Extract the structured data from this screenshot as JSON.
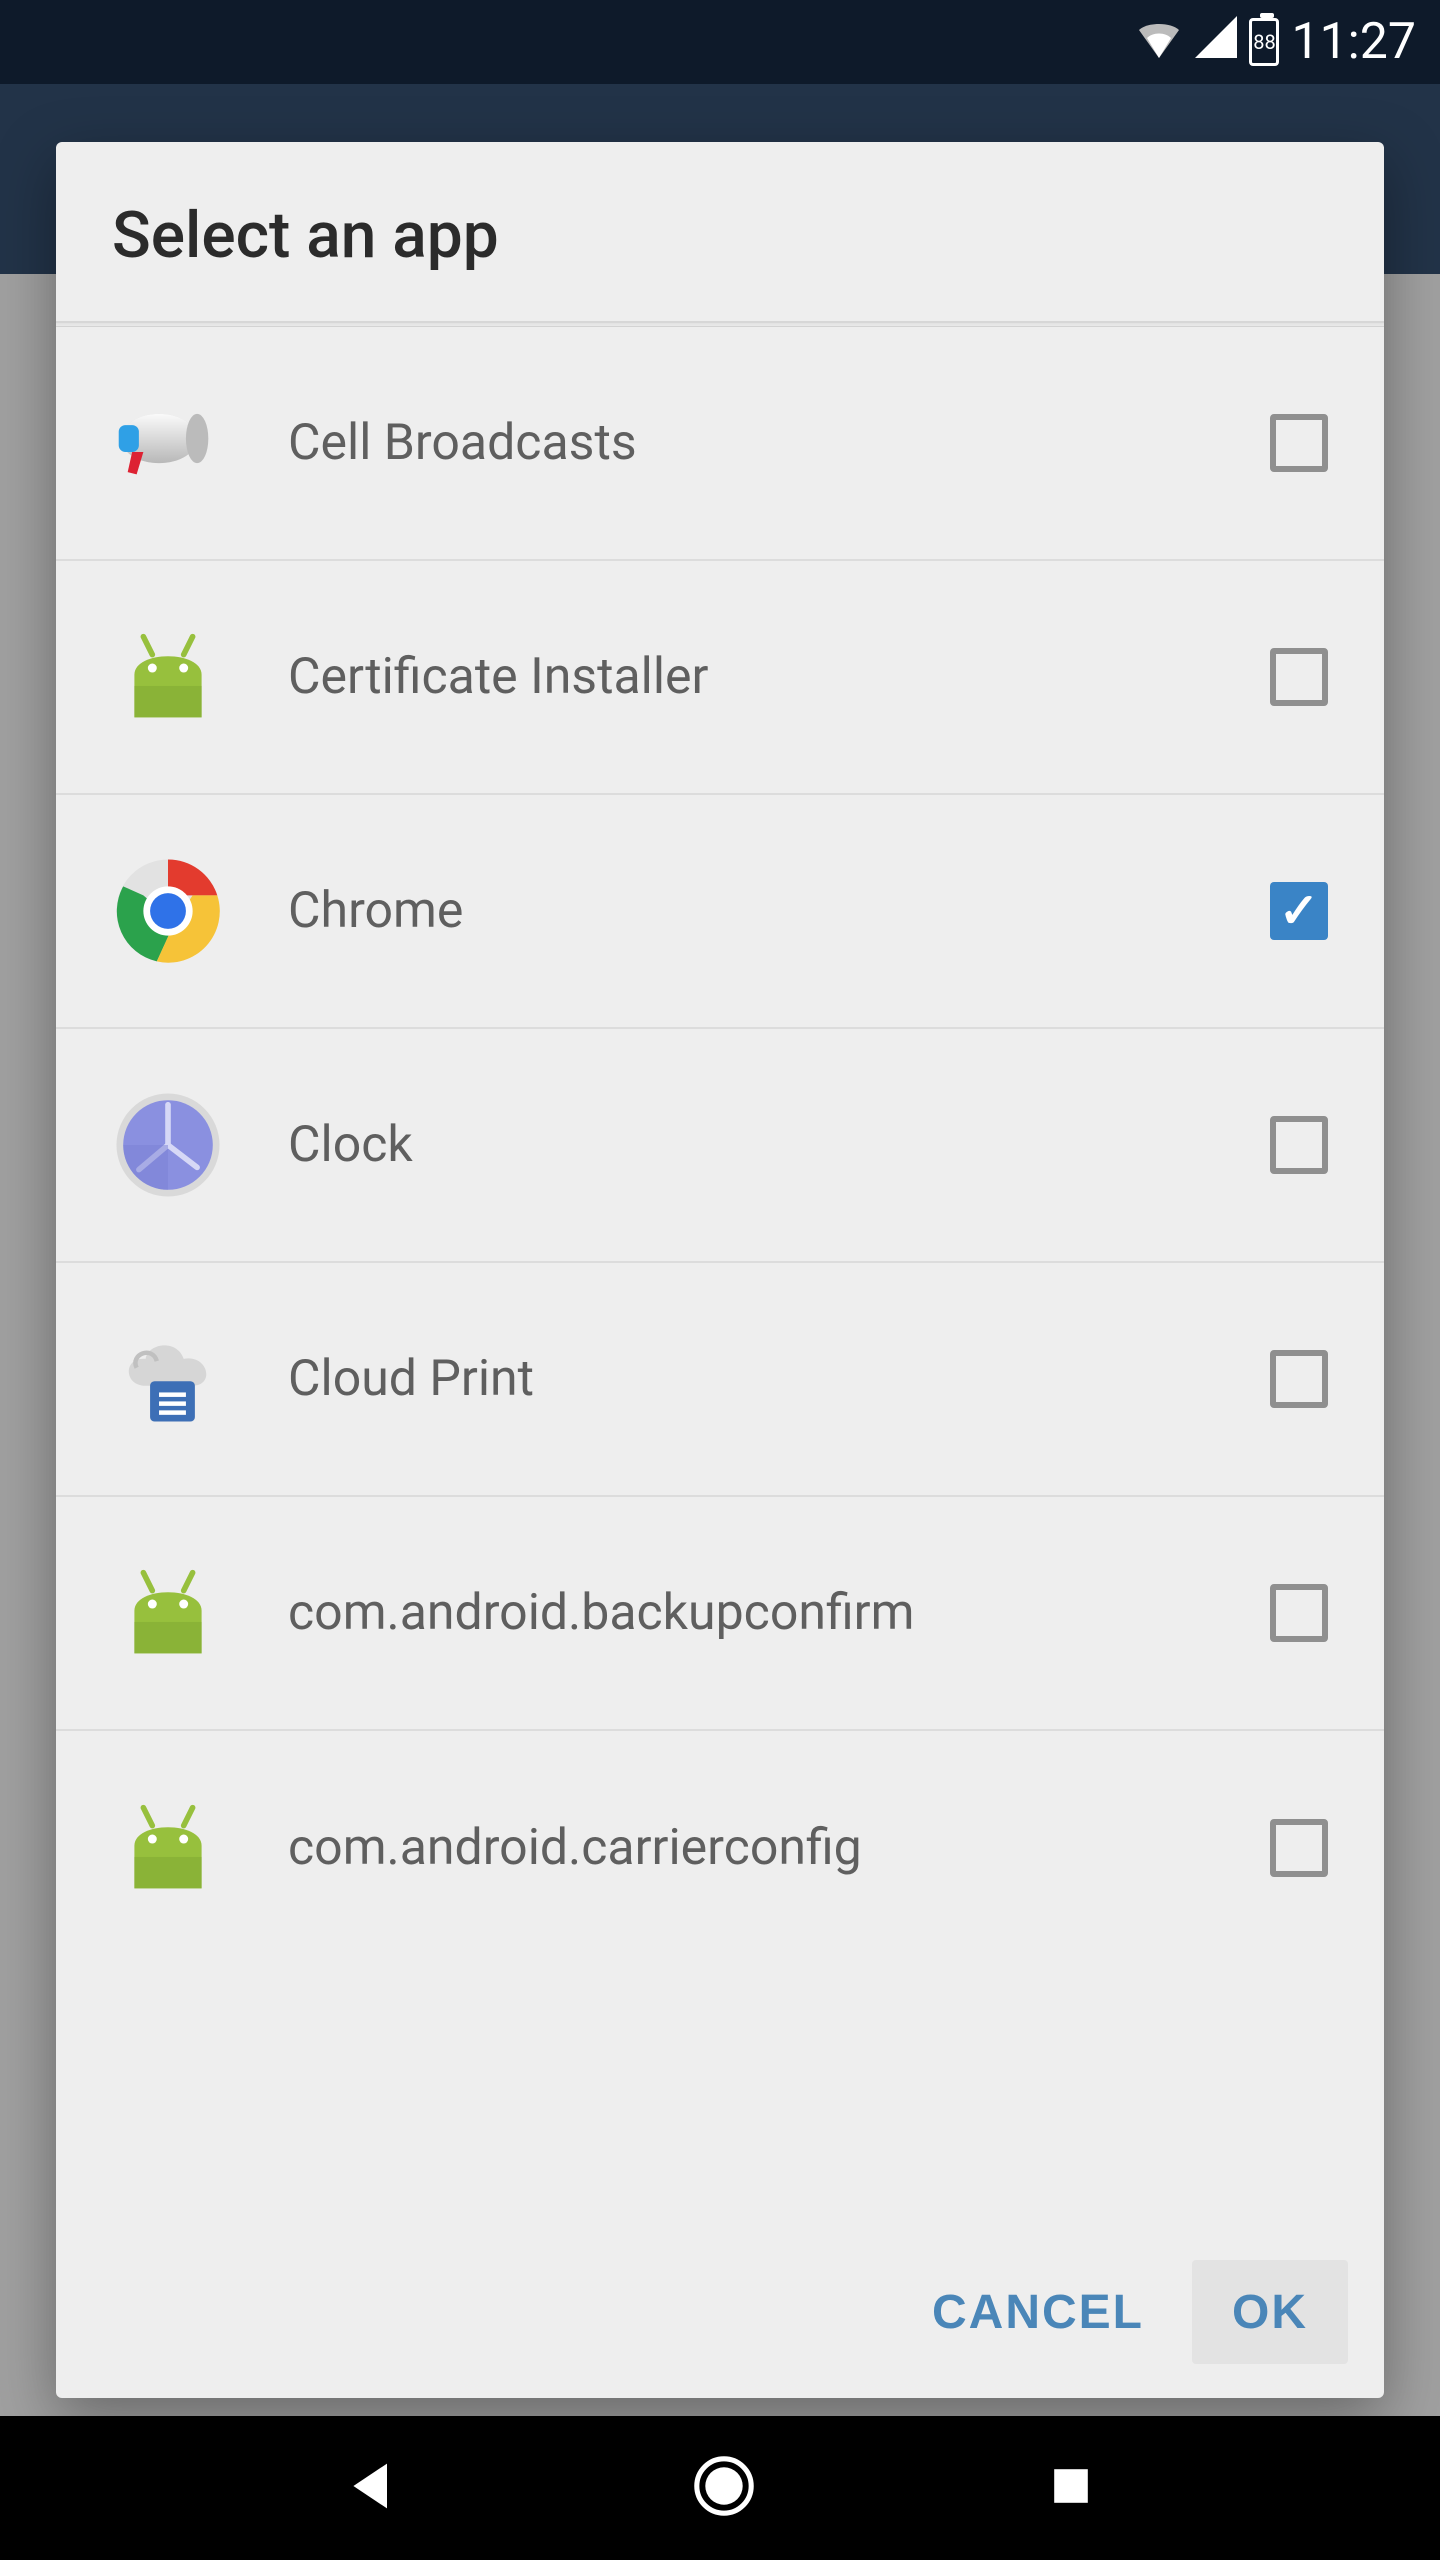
{
  "statusbar": {
    "time": "11:27",
    "battery": "88"
  },
  "dialog": {
    "title": "Select an app",
    "apps": [
      {
        "name": "Cell Broadcasts",
        "checked": false,
        "icon": "megaphone-icon"
      },
      {
        "name": "Certificate Installer",
        "checked": false,
        "icon": "android-icon"
      },
      {
        "name": "Chrome",
        "checked": true,
        "icon": "chrome-icon"
      },
      {
        "name": "Clock",
        "checked": false,
        "icon": "clock-icon"
      },
      {
        "name": "Cloud Print",
        "checked": false,
        "icon": "cloud-print-icon"
      },
      {
        "name": "com.android.backupconfirm",
        "checked": false,
        "icon": "android-icon"
      },
      {
        "name": "com.android.carrierconfig",
        "checked": false,
        "icon": "android-icon"
      }
    ],
    "cancel": "CANCEL",
    "ok": "OK"
  }
}
